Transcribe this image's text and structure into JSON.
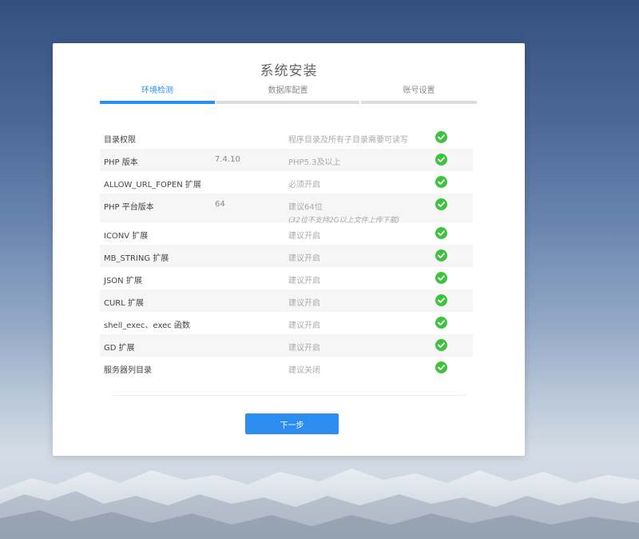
{
  "title": "系统安装",
  "steps": [
    {
      "label": "环境检测",
      "active": true
    },
    {
      "label": "数据库配置",
      "active": false
    },
    {
      "label": "账号设置",
      "active": false
    }
  ],
  "checks": [
    {
      "name": "目录权限",
      "value": "",
      "requirement": "程序目录及所有子目录需要可读写",
      "note": "",
      "status": "ok"
    },
    {
      "name": "PHP 版本",
      "value": "7.4.10",
      "requirement": "PHP5.3及以上",
      "note": "",
      "status": "ok"
    },
    {
      "name": "ALLOW_URL_FOPEN 扩展",
      "value": "",
      "requirement": "必须开启",
      "note": "",
      "status": "ok"
    },
    {
      "name": "PHP 平台版本",
      "value": "64",
      "requirement": "建议64位",
      "note": "(32位不支持2G以上文件上传下载)",
      "status": "ok"
    },
    {
      "name": "ICONV 扩展",
      "value": "",
      "requirement": "建议开启",
      "note": "",
      "status": "ok"
    },
    {
      "name": "MB_STRING 扩展",
      "value": "",
      "requirement": "建议开启",
      "note": "",
      "status": "ok"
    },
    {
      "name": "JSON 扩展",
      "value": "",
      "requirement": "建议开启",
      "note": "",
      "status": "ok"
    },
    {
      "name": "CURL 扩展",
      "value": "",
      "requirement": "建议开启",
      "note": "",
      "status": "ok"
    },
    {
      "name": "shell_exec、exec 函数",
      "value": "",
      "requirement": "建议开启",
      "note": "",
      "status": "ok"
    },
    {
      "name": "GD 扩展",
      "value": "",
      "requirement": "建议开启",
      "note": "",
      "status": "ok"
    },
    {
      "name": "服务器列目录",
      "value": "",
      "requirement": "建议关闭",
      "note": "",
      "status": "ok"
    }
  ],
  "next_button": {
    "label": "下一步"
  },
  "colors": {
    "accent": "#2d8cf0",
    "ok": "#3fc33f",
    "inactive_bar": "#dcdcdc"
  },
  "icons": {
    "status_ok": "check-circle-icon"
  }
}
